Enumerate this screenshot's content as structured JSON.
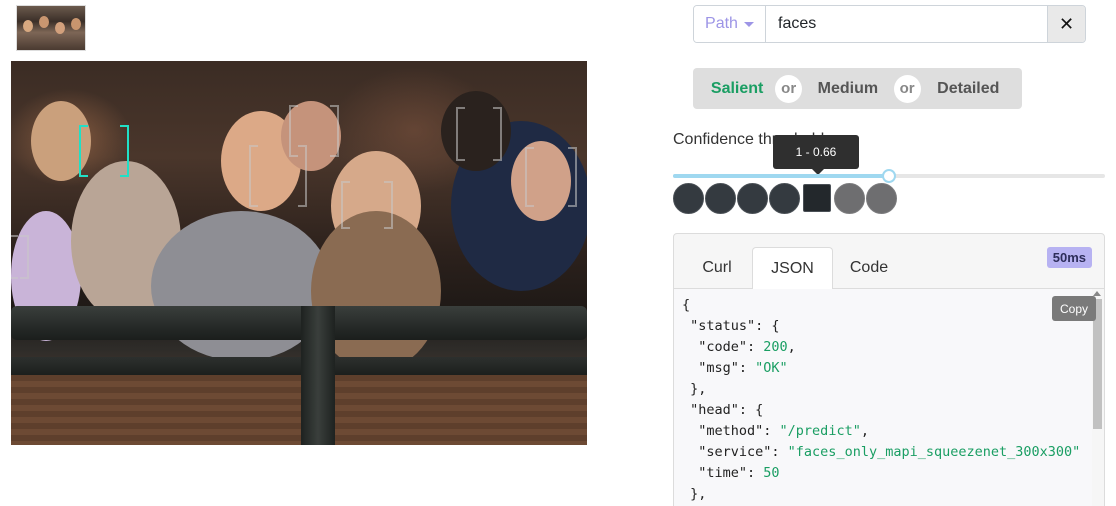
{
  "search": {
    "path_label": "Path",
    "query": "faces",
    "clear_icon": "close-icon"
  },
  "detail_levels": {
    "salient": "Salient",
    "or1": "or",
    "medium": "Medium",
    "or2": "or",
    "detailed": "Detailed"
  },
  "confidence": {
    "label": "Confidence threshold",
    "tooltip": "1 - 0.66",
    "value": 0.5
  },
  "tabs": {
    "curl": "Curl",
    "json": "JSON",
    "code": "Code",
    "active": "JSON"
  },
  "timing_badge": "50ms",
  "copy_label": "Copy",
  "json_lines": [
    "{",
    " \"status\": {",
    "  \"code\": 200,",
    "  \"msg\": \"OK\"",
    " },",
    " \"head\": {",
    "  \"method\": \"/predict\",",
    "  \"service\": \"faces_only_mapi_squeezenet_300x300\"",
    "  \"time\": 50",
    " },"
  ],
  "colors": {
    "accent": "#9d95e6",
    "highlight_box": "#21e0c6",
    "slider": "#9fd8f0",
    "badge": "#b7b2f2"
  }
}
